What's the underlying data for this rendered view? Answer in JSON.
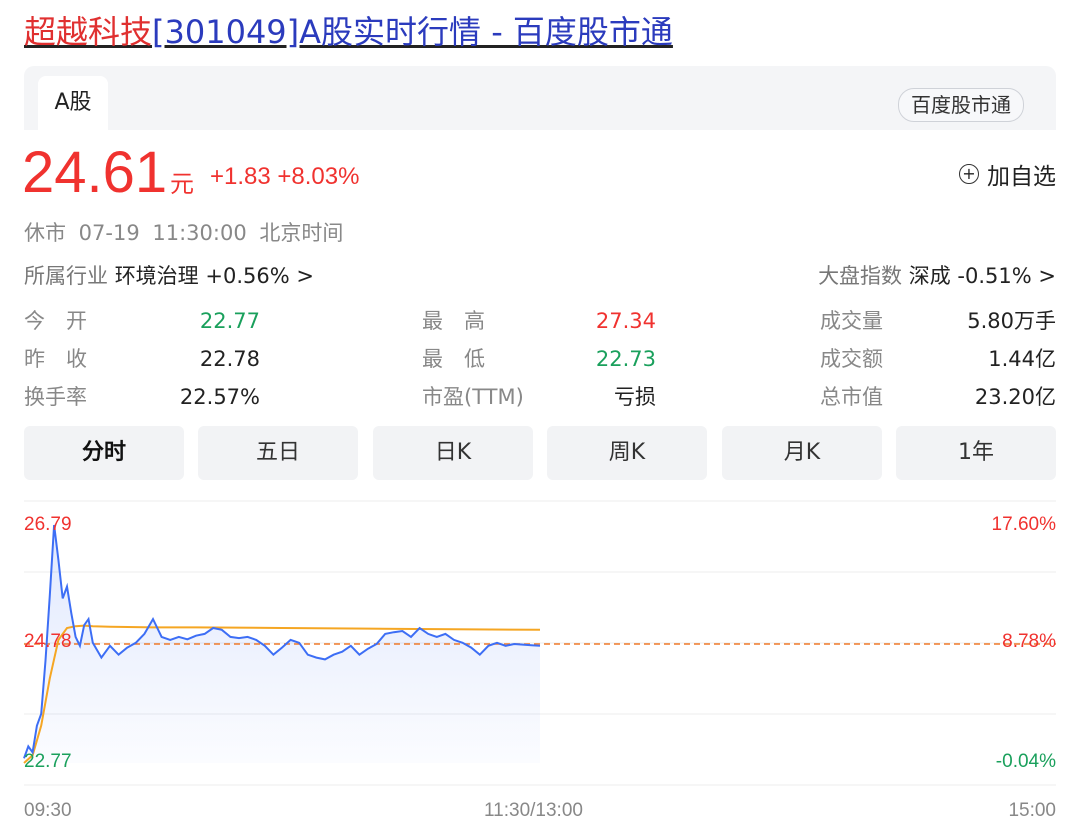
{
  "header": {
    "title_name": "超越科技",
    "title_rest": "[301049]A股实时行情 - 百度股市通"
  },
  "tabs": {
    "active": "A股",
    "source_pill": "百度股市通"
  },
  "quote": {
    "price": "24.61",
    "unit": "元",
    "change": "+1.83 +8.03%",
    "add_watch": "加自选",
    "status_line": "休市 07-19 11:30:00 北京时间",
    "industry_label": "所属行业",
    "industry_value": "环境治理 +0.56% >",
    "index_label": "大盘指数",
    "index_value": "深成 -0.51% >"
  },
  "stats": {
    "open_label": "今　开",
    "open": "22.77",
    "prev_close_label": "昨　收",
    "prev_close": "22.78",
    "turnover_rate_label": "换手率",
    "turnover_rate": "22.57%",
    "high_label": "最　高",
    "high": "27.34",
    "low_label": "最　低",
    "low": "22.73",
    "pe_label": "市盈(TTM)",
    "pe": "亏损",
    "volume_label": "成交量",
    "volume": "5.80万手",
    "amount_label": "成交额",
    "amount": "1.44亿",
    "mcap_label": "总市值",
    "mcap": "23.20亿"
  },
  "periods": [
    "分时",
    "五日",
    "日K",
    "周K",
    "月K",
    "1年"
  ],
  "colors": {
    "up": "#f0322f",
    "down": "#1aa05c",
    "price_line": "#3d6ef5",
    "avg_line": "#f5a623",
    "prev_close_line": "#f07a2a"
  },
  "chart_data": {
    "type": "line",
    "y_left_ticks": [
      "26.79",
      "24.78",
      "22.77"
    ],
    "y_right_ticks": [
      "17.60%",
      "8.78%",
      "-0.04%"
    ],
    "x_ticks": [
      "09:30",
      "11:30/13:00",
      "15:00"
    ],
    "ylim": [
      22.77,
      26.79
    ],
    "xlim_minutes": [
      0,
      240
    ],
    "reference_line": 24.78,
    "series": [
      {
        "key": "price",
        "x": [
          0,
          1,
          2,
          3,
          4,
          5,
          6,
          7,
          8,
          9,
          10,
          11,
          12,
          13,
          14,
          15,
          16,
          18,
          20,
          22,
          24,
          26,
          28,
          30,
          32,
          34,
          36,
          38,
          40,
          42,
          44,
          46,
          48,
          50,
          52,
          54,
          56,
          58,
          60,
          62,
          64,
          66,
          68,
          70,
          72,
          74,
          76,
          78,
          80,
          82,
          84,
          86,
          88,
          90,
          92,
          94,
          96,
          98,
          100,
          102,
          104,
          106,
          108,
          110,
          112,
          114,
          116,
          118,
          120
        ],
        "y": [
          22.85,
          23.05,
          22.95,
          23.4,
          23.6,
          24.5,
          25.6,
          26.79,
          26.2,
          25.55,
          25.75,
          25.3,
          24.9,
          24.75,
          25.1,
          25.2,
          24.8,
          24.55,
          24.75,
          24.6,
          24.72,
          24.8,
          24.95,
          25.2,
          24.9,
          24.85,
          24.9,
          24.86,
          24.92,
          24.95,
          25.05,
          25.02,
          24.9,
          24.88,
          24.9,
          24.85,
          24.75,
          24.6,
          24.72,
          24.85,
          24.8,
          24.6,
          24.55,
          24.52,
          24.6,
          24.65,
          24.75,
          24.6,
          24.7,
          24.78,
          24.95,
          24.98,
          25.0,
          24.9,
          25.05,
          24.95,
          24.9,
          24.95,
          24.85,
          24.8,
          24.72,
          24.6,
          24.75,
          24.8,
          24.75,
          24.78,
          24.77,
          24.76,
          24.75
        ]
      },
      {
        "key": "avg",
        "x": [
          0,
          2,
          4,
          6,
          8,
          10,
          12,
          14,
          16,
          20,
          30,
          40,
          60,
          80,
          100,
          120
        ],
        "y": [
          22.77,
          22.9,
          23.4,
          24.2,
          24.85,
          25.05,
          25.08,
          25.09,
          25.08,
          25.07,
          25.06,
          25.06,
          25.05,
          25.04,
          25.03,
          25.02
        ]
      }
    ]
  }
}
